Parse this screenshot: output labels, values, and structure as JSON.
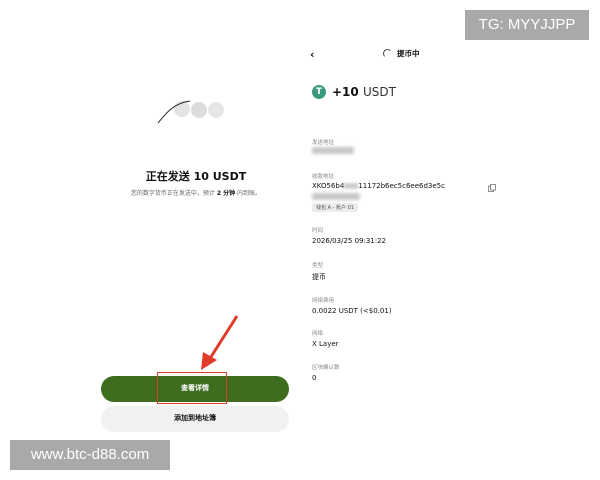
{
  "watermarks": {
    "top": "TG: MYYJJPP",
    "bottom": "www.btc-d88.com"
  },
  "left_panel": {
    "title": "正在发送 10 USDT",
    "subtitle_before": "您的数字货币正在发送中，预计",
    "subtitle_bold": "2 分钟",
    "subtitle_after": "内到账。",
    "primary_button": "查看详情",
    "secondary_button": "添加到地址簿"
  },
  "right_panel": {
    "header_title": "提币中",
    "amount": "+10",
    "currency": "USDT",
    "icon_symbol": "T",
    "fields": {
      "from_label": "发送地址",
      "to_label": "收款地址",
      "to_value_line1": "XKO56b4",
      "to_value_mid": "11172b6ec5c6ee6d3e5c",
      "wallet_tag": "钱包 A - 账户 01",
      "time_label": "时间",
      "time_value": "2026/03/25 09:31:22",
      "type_label": "类型",
      "type_value": "提币",
      "fee_label": "网络费用",
      "fee_value": "0.0022 USDT (<$0.01)",
      "network_label": "网络",
      "network_value": "X Layer",
      "confirm_label": "区块确认数",
      "confirm_value": "0"
    }
  },
  "colors": {
    "primary_button": "#3e6d1f",
    "usdt_icon": "#3a9a7d",
    "highlight": "#e03a2a"
  }
}
